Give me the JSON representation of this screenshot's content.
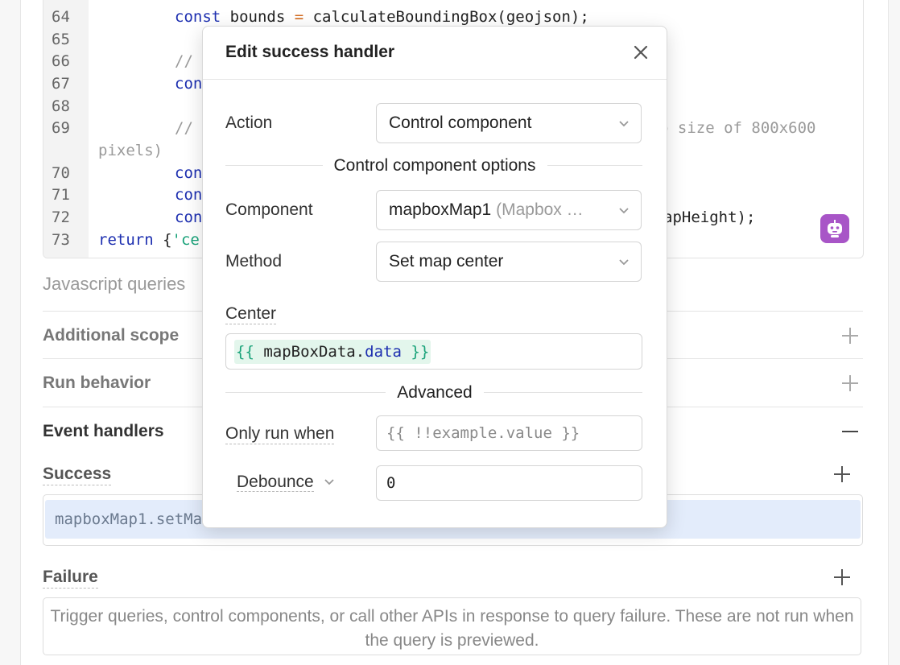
{
  "editor": {
    "lines": [
      {
        "num": "64",
        "parts": [
          [
            "kw",
            "const"
          ],
          [
            "",
            " bounds "
          ],
          [
            "op",
            "="
          ],
          [
            "",
            " calculateBoundingBox(geojson);"
          ]
        ]
      },
      {
        "num": "65",
        "parts": []
      },
      {
        "num": "66",
        "parts": [
          [
            "cm",
            "//"
          ]
        ]
      },
      {
        "num": "67",
        "parts": [
          [
            "kw",
            "con"
          ]
        ]
      },
      {
        "num": "68",
        "parts": []
      },
      {
        "num": "69",
        "parts": [
          [
            "cm",
            "//"
          ]
        ],
        "tail": "p size of 800x600"
      },
      {
        "num": "70",
        "parts": [
          [
            "kw",
            "con"
          ]
        ]
      },
      {
        "num": "71",
        "parts": [
          [
            "kw",
            "con"
          ]
        ]
      },
      {
        "num": "72",
        "parts": [
          [
            "kw",
            "con"
          ]
        ],
        "tail": "apHeight);"
      },
      {
        "num": "73",
        "parts": [
          [
            "kw",
            "return"
          ],
          [
            "",
            " {"
          ],
          [
            "str",
            "'ce"
          ]
        ]
      }
    ],
    "wrap_text": "pixels)"
  },
  "js_queries_label": "Javascript queries",
  "sections": {
    "additional_scope": "Additional scope",
    "run_behavior": "Run behavior",
    "event_handlers": "Event handlers"
  },
  "success": {
    "label": "Success",
    "handler_text": "mapboxMap1.setMa"
  },
  "failure": {
    "label": "Failure",
    "empty_text": "Trigger queries, control components, or call other APIs in response to query failure. These are not run when the query is previewed."
  },
  "modal": {
    "title": "Edit success handler",
    "action_label": "Action",
    "action_value": "Control component",
    "options_heading": "Control component options",
    "component_label": "Component",
    "component_value": "mapboxMap1",
    "component_type": "(Mapbox …",
    "method_label": "Method",
    "method_value": "Set map center",
    "center_label": "Center",
    "center_value": {
      "open": "{{ ",
      "obj": "mapBoxData",
      "dot": ".",
      "prop": "data",
      "close": " }}"
    },
    "advanced_heading": "Advanced",
    "only_run_when_label": "Only run when",
    "only_run_when_placeholder": "{{ !!example.value }}",
    "debounce_label": "Debounce",
    "debounce_value": "0"
  },
  "colors": {
    "accent_robot": "#a855c7",
    "keyword": "#1d2fb0",
    "string": "#1aa37a",
    "selected_row": "#e3ecfb"
  },
  "icons": [
    "close-icon",
    "chevron-down-icon",
    "plus-icon",
    "minus-icon",
    "robot-icon"
  ]
}
